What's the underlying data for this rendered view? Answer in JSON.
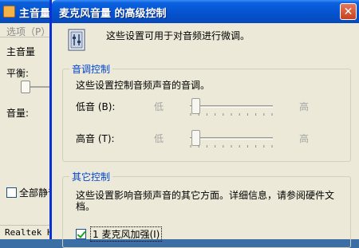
{
  "background_window": {
    "title": "主音量",
    "menu_options": "选项（P）",
    "mixer_label": "主音量",
    "balance_label": "平衡:",
    "volume_label": "音量:",
    "mute_all_label": "全部静音",
    "status_text": "Realtek HD"
  },
  "dialog": {
    "title": "麦克风音量  的高级控制",
    "close_glyph": "✕",
    "description": "这些设置可用于对音频进行微调。",
    "tone_controls": {
      "title": "音调控制",
      "description": "这些设置控制音频声音的音调。",
      "sliders": [
        {
          "label": "低音 (B):",
          "min_label": "低",
          "max_label": "高",
          "level": 0.05
        },
        {
          "label": "高音 (T):",
          "min_label": "低",
          "max_label": "高",
          "level": 0.05
        }
      ]
    },
    "other_controls": {
      "title": "其它控制",
      "description_line1": "这些设置影响音频声音的其它方面。详细信息，请参阅硬件文",
      "description_line2": "档。",
      "checkbox_label": "1  麦克风加强(I)",
      "checkbox_checked": true
    }
  }
}
